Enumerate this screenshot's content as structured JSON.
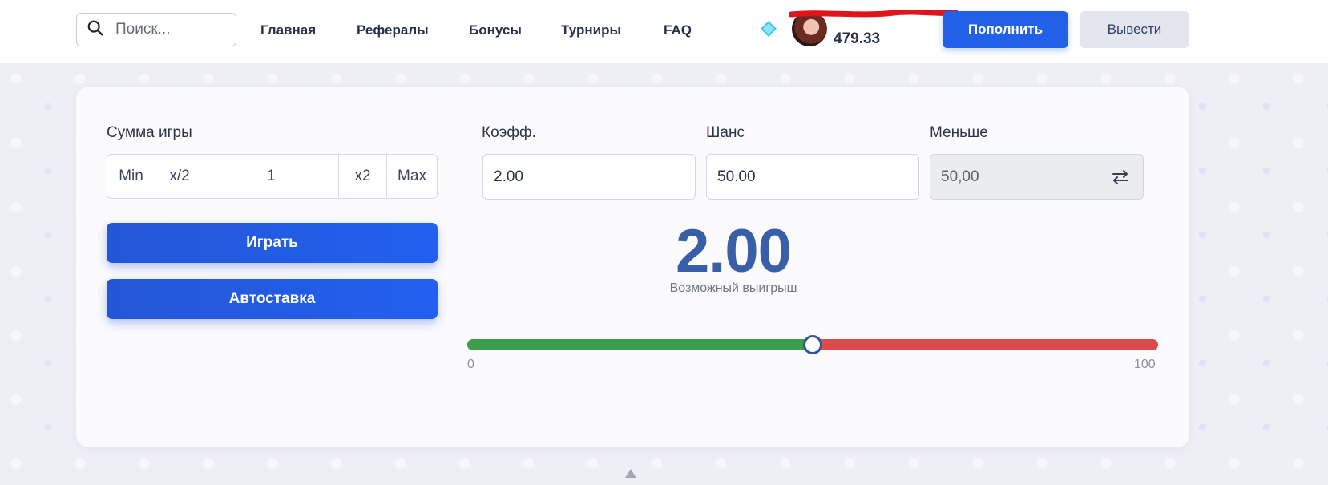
{
  "header": {
    "search_placeholder": "Поиск...",
    "nav": [
      {
        "label": "Главная"
      },
      {
        "label": "Рефералы"
      },
      {
        "label": "Бонусы"
      },
      {
        "label": "Турниры"
      },
      {
        "label": "FAQ"
      }
    ],
    "balance": "479.33",
    "deposit_label": "Пополнить",
    "withdraw_label": "Вывести",
    "icons": {
      "search": "search-icon",
      "gem": "diamond-icon"
    },
    "colors": {
      "accent": "#2360e8"
    }
  },
  "game": {
    "bet_label": "Сумма игры",
    "bet_min": "Min",
    "bet_half": "x/2",
    "bet_value": "1",
    "bet_double": "x2",
    "bet_max": "Max",
    "coef_label": "Коэфф.",
    "coef_value": "2.00",
    "chance_label": "Шанс",
    "chance_value": "50.00",
    "mode_label": "Меньше",
    "mode_value": "50,00",
    "play_label": "Играть",
    "autobet_label": "Автоставка",
    "payout_value": "2.00",
    "payout_caption": "Возможный выигрыш",
    "slider": {
      "min": "0",
      "max": "100",
      "value": 50,
      "colors": {
        "win": "#3e9d4a",
        "lose": "#dd4a4c"
      }
    }
  }
}
